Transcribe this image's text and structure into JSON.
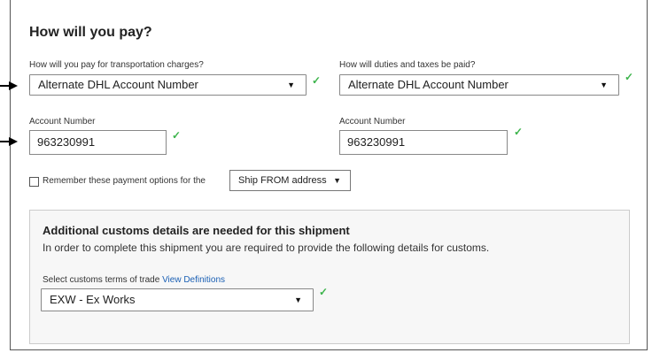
{
  "heading": "How will you pay?",
  "transport": {
    "label": "How will you pay for transportation charges?",
    "selected": "Alternate DHL Account Number",
    "account_label": "Account Number",
    "account_value": "963230991"
  },
  "duties": {
    "label": "How will duties and taxes be paid?",
    "selected": "Alternate DHL Account Number",
    "account_label": "Account Number",
    "account_value": "963230991"
  },
  "remember": {
    "label": "Remember these payment options for the",
    "checked": false,
    "dropdown_value": "Ship FROM address"
  },
  "customs": {
    "title": "Additional customs details are needed for this shipment",
    "description": "In order to complete this shipment you are required to provide the following details for customs.",
    "terms_label": "Select customs terms of trade",
    "terms_link": "View Definitions",
    "terms_selected": "EXW - Ex Works"
  },
  "colors": {
    "checkmark": "#3cb44b",
    "link": "#1a5fb4",
    "border": "#555555"
  }
}
